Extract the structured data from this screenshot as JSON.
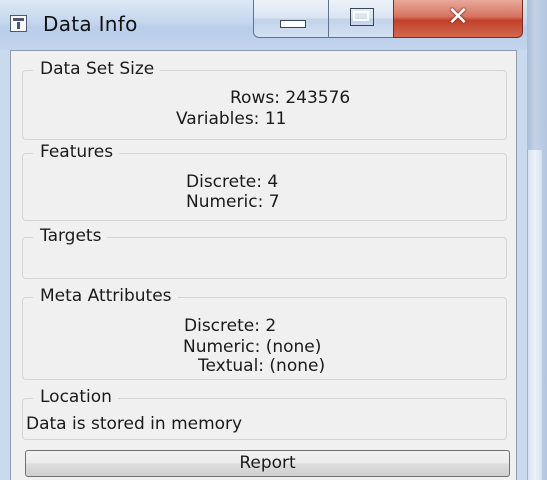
{
  "window": {
    "title": "Data Info",
    "icon": "info-icon"
  },
  "groups": {
    "data_set_size": {
      "title": "Data Set Size",
      "rows": "Rows: 243576",
      "variables": "Variables: 11"
    },
    "features": {
      "title": "Features",
      "discrete": "Discrete: 4",
      "numeric": "Numeric: 7"
    },
    "targets": {
      "title": "Targets"
    },
    "meta_attributes": {
      "title": "Meta Attributes",
      "discrete": "Discrete: 2",
      "numeric": "Numeric: (none)",
      "textual": "Textual: (none)"
    },
    "location": {
      "title": "Location",
      "text": "Data is stored in memory"
    }
  },
  "buttons": {
    "report": "Report"
  },
  "colors": {
    "close_button": "#c2402a",
    "titlebar": "#c4d6ee",
    "client_background": "#f0f0f0"
  }
}
